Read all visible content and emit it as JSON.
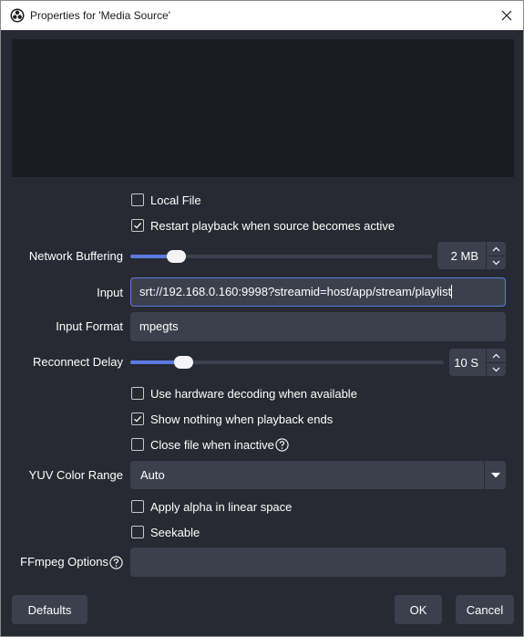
{
  "window": {
    "title": "Properties for 'Media Source'",
    "app_icon": "obs-logo-icon",
    "close_icon": "close-icon"
  },
  "properties": {
    "local_file": {
      "label": "Local File",
      "checked": false
    },
    "restart_playback": {
      "label": "Restart playback when source becomes active",
      "checked": true
    },
    "network_buffering": {
      "label": "Network Buffering",
      "value": "2 MB",
      "slider_percent": 15
    },
    "input": {
      "label": "Input",
      "value": "srt://192.168.0.160:9998?streamid=host/app/stream/playlist"
    },
    "input_format": {
      "label": "Input Format",
      "value": "mpegts"
    },
    "reconnect_delay": {
      "label": "Reconnect Delay",
      "value": "10 S",
      "slider_percent": 17
    },
    "hw_decoding": {
      "label": "Use hardware decoding when available",
      "checked": false
    },
    "show_nothing": {
      "label": "Show nothing when playback ends",
      "checked": true
    },
    "close_inactive": {
      "label": "Close file when inactive",
      "checked": false
    },
    "yuv_color_range": {
      "label": "YUV Color Range",
      "value": "Auto"
    },
    "alpha_linear": {
      "label": "Apply alpha in linear space",
      "checked": false
    },
    "seekable": {
      "label": "Seekable",
      "checked": false
    },
    "ffmpeg_options": {
      "label": "FFmpeg Options",
      "value": ""
    }
  },
  "buttons": {
    "defaults": "Defaults",
    "ok": "OK",
    "cancel": "Cancel"
  },
  "colors": {
    "background": "#272a33",
    "field": "#3c404d",
    "accent": "#5b79e0",
    "preview": "#1b1c21"
  }
}
